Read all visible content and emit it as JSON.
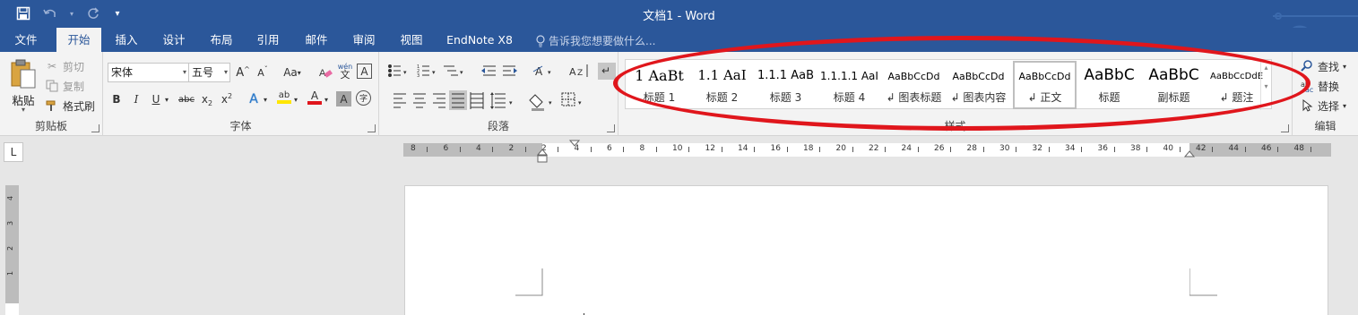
{
  "window": {
    "title": "文档1 - Word"
  },
  "quick_access": {
    "save_icon": "save-icon",
    "undo_icon": "undo-icon",
    "redo_icon": "redo-icon",
    "customize_icon": "customize-qat-icon"
  },
  "tabs": [
    {
      "label": "文件"
    },
    {
      "label": "开始"
    },
    {
      "label": "插入"
    },
    {
      "label": "设计"
    },
    {
      "label": "布局"
    },
    {
      "label": "引用"
    },
    {
      "label": "邮件"
    },
    {
      "label": "审阅"
    },
    {
      "label": "视图"
    },
    {
      "label": "EndNote X8"
    }
  ],
  "active_tab": "开始",
  "tell_me": {
    "placeholder": "告诉我您想要做什么..."
  },
  "clipboard": {
    "paste_label": "粘贴",
    "cut_label": "剪切",
    "copy_label": "复制",
    "format_painter_label": "格式刷",
    "group_label": "剪贴板"
  },
  "font": {
    "name_value": "宋体",
    "size_value": "五号",
    "change_case": "Aa",
    "phonetic_top": "wén",
    "phonetic_bottom": "文",
    "border_char": "A",
    "encircle_char": "字",
    "bold": "B",
    "italic": "I",
    "underline": "U",
    "strike": "abc",
    "subscript_base": "x",
    "subscript_mark": "2",
    "superscript_base": "x",
    "superscript_mark": "2",
    "effects_char": "A",
    "highlight_char": "ab",
    "font_color_char": "A",
    "shading_char": "A",
    "grow_base": "A",
    "grow_mark": "^",
    "shrink_base": "A",
    "shrink_mark": "ˇ",
    "group_label": "字体"
  },
  "paragraph": {
    "group_label": "段落"
  },
  "styles": {
    "group_label": "样式",
    "items": [
      {
        "sample": "1  AaBt",
        "name": "标题 1"
      },
      {
        "sample": "1.1  AaI",
        "name": "标题 2"
      },
      {
        "sample": "1.1.1  AaB",
        "name": "标题 3"
      },
      {
        "sample": "1.1.1.1  AaI",
        "name": "标题 4"
      },
      {
        "sample": "AaBbCcDd",
        "name": "↲ 图表标题"
      },
      {
        "sample": "AaBbCcDd",
        "name": "↲ 图表内容"
      },
      {
        "sample": "AaBbCcDd",
        "name": "↲ 正文"
      },
      {
        "sample": "AaBbC",
        "name": "标题"
      },
      {
        "sample": "AaBbC",
        "name": "副标题"
      },
      {
        "sample": "AaBbCcDdE",
        "name": "↲ 题注"
      }
    ],
    "selected_index": 6
  },
  "editing": {
    "find_label": "查找",
    "replace_label": "替换",
    "select_label": "选择",
    "group_label": "编辑"
  },
  "ruler": {
    "corner_symbol": "L",
    "numbers": [
      "8",
      "6",
      "4",
      "2",
      "2",
      "4",
      "6",
      "8",
      "10",
      "12",
      "14",
      "16",
      "18",
      "20",
      "22",
      "24",
      "26",
      "28",
      "30",
      "32",
      "34",
      "36",
      "38",
      "40",
      "42",
      "44",
      "46",
      "48"
    ],
    "vertical_numbers": [
      "4",
      "3",
      "2",
      "1"
    ]
  },
  "annotation": {
    "color": "#e0161c"
  },
  "colors": {
    "brand": "#2b579a",
    "ribbon_bg": "#f3f3f3",
    "canvas_bg": "#e6e6e6"
  }
}
